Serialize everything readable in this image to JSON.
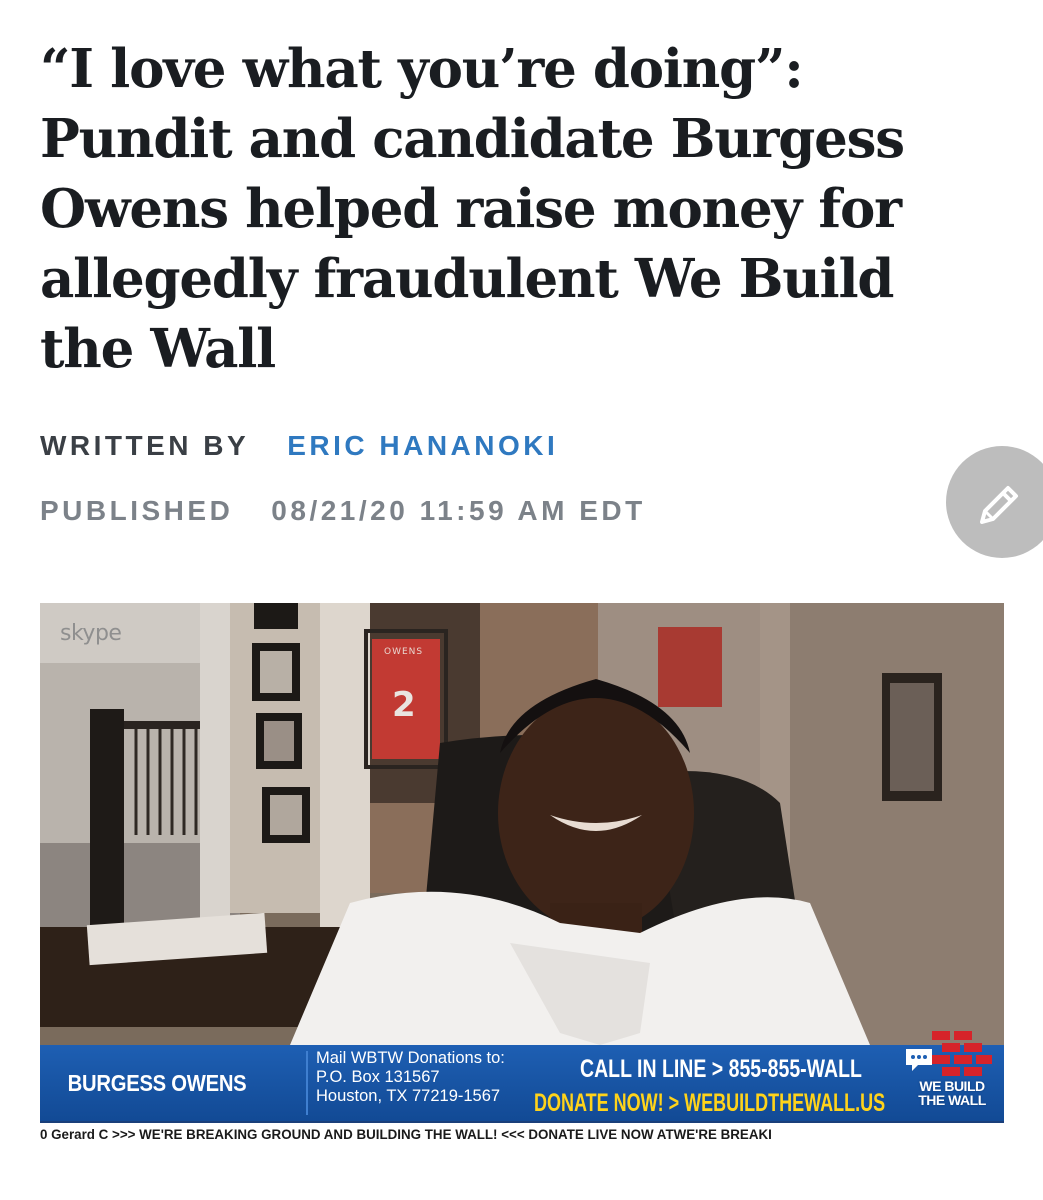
{
  "article": {
    "headline": "“I love what you’re doing”: Pundit and candidate Burgess Owens helped raise money for allegedly fraudulent We Build the Wall",
    "written_by_label": "WRITTEN BY",
    "author": "ERIC HANANOKI",
    "published_label": "PUBLISHED",
    "published_date": "08/21/20 11:59 AM EDT"
  },
  "video": {
    "watermark": "skype",
    "jersey_name": "OWENS",
    "jersey_number": "2",
    "lower_third": {
      "name": "BURGESS OWENS",
      "mail_line1": "Mail WBTW Donations to:",
      "mail_line2": "P.O. Box 131567",
      "mail_line3": "Houston, TX 77219-1567",
      "call_line": "CALL IN LINE > 855-855-WALL",
      "donate_line": "DONATE NOW! > WEBUILDTHEWALL.US",
      "logo_line1": "WE BUILD",
      "logo_line2": "THE WALL"
    },
    "ticker": "0 Gerard C >>> WE'RE BREAKING GROUND AND BUILDING THE WALL! <<< DONATE LIVE NOW ATWE'RE BREAKI"
  },
  "icons": {
    "edit": "pencil-icon"
  },
  "colors": {
    "headline": "#1a1d21",
    "author_link": "#2f79c0",
    "meta_grey": "#7c8289",
    "banner_blue": "#1e5fb3",
    "donate_yellow": "#ffd31a"
  }
}
